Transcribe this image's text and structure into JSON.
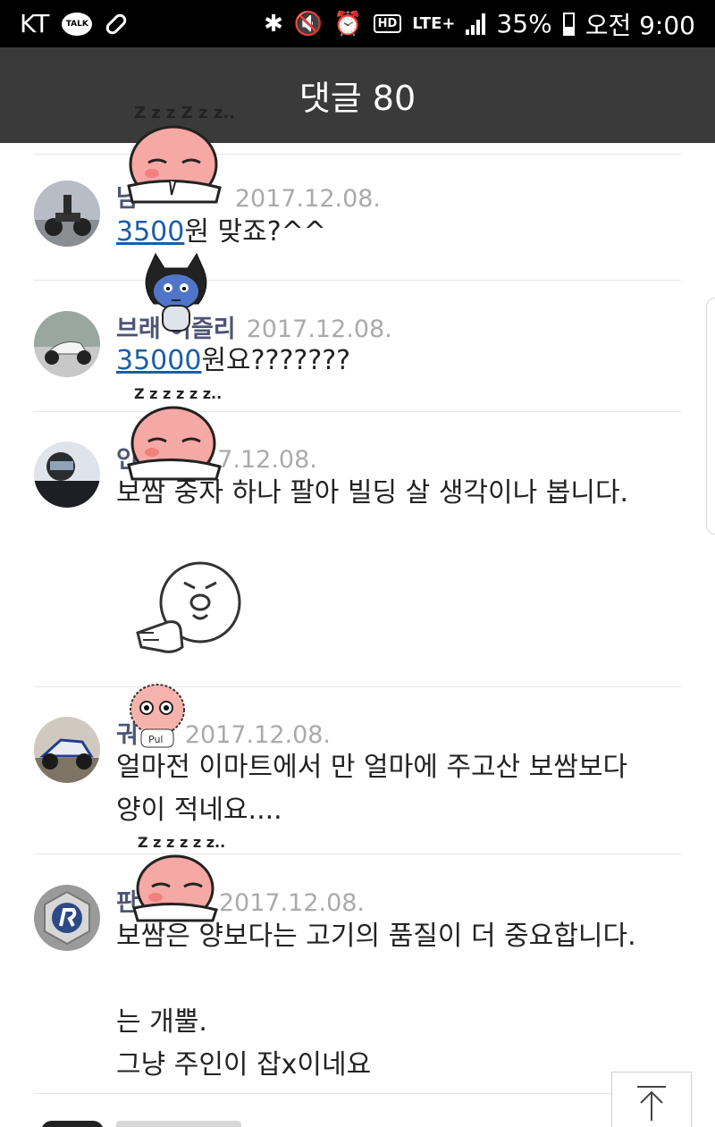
{
  "status_bar": {
    "carrier": "KT",
    "talk_label": "TALK",
    "hd_label": "HD",
    "lte_label": "LTE+",
    "battery": "35%",
    "time": "오전 9:00"
  },
  "header": {
    "title": "댓글 80"
  },
  "comments": [
    {
      "author": "남",
      "date": "2017.12.08.",
      "link_text": "3500",
      "text_after_link": "원 맞죠?^^"
    },
    {
      "author": "브래   이즐리",
      "date": "2017.12.08.",
      "link_text": "35000",
      "text_after_link": "원요???????"
    },
    {
      "author": "        인생",
      "date": "2017.12.08.",
      "text": "보쌈 중자 하나 팔아 빌딩 살 생각이나 봅니다."
    },
    {
      "author": "궈",
      "date": "2017.12.08.",
      "text": "얼마전 이마트에서 만 얼마에 주고산 보쌈보다\n양이 적네요...."
    },
    {
      "author": "판",
      "date": "2017.12.08.",
      "text": "보쌈은 양보다는 고기의 품질이 더 중요합니다.\n\n는 개뿔.\n그냥 주인이 잡x이네요"
    }
  ],
  "stickers": {
    "sleep_text": "Z z z Z z z..",
    "sleep_text_short": "Z z z z z z..",
    "pul_text": "Pul"
  },
  "colors": {
    "header_bg": "#3a3a3a",
    "author": "#4d5573",
    "date": "#aaaaaa",
    "link": "#1b5da8"
  }
}
